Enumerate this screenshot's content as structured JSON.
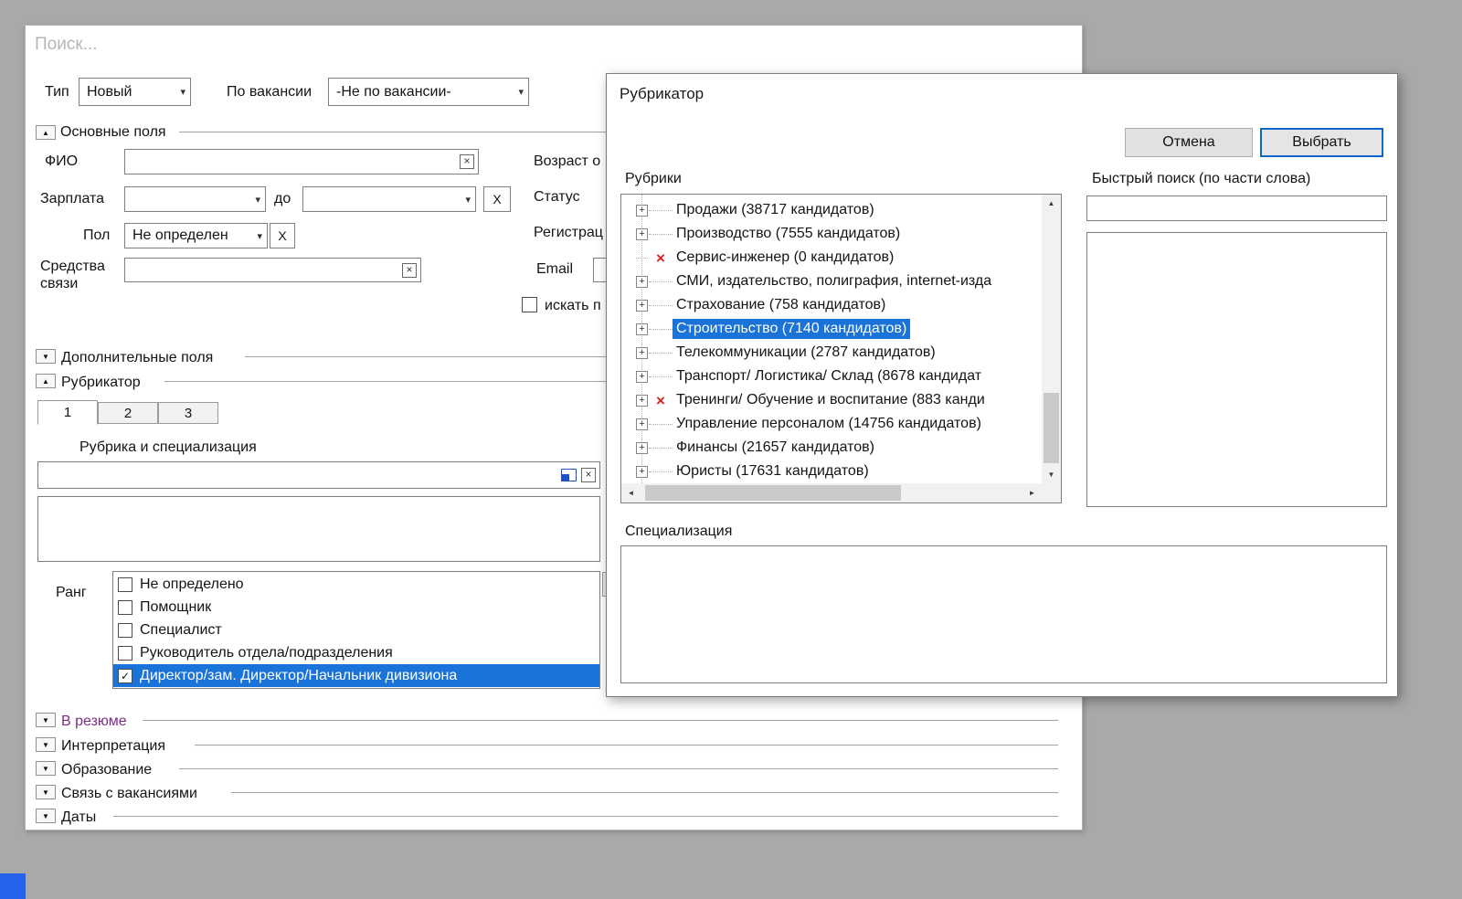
{
  "colors": {
    "selection_blue": "#1a73d9",
    "deleted_red": "#d81e1e",
    "default_button_border": "#0b68c9",
    "resume_purple": "#7d2c84",
    "background_gray": "#a9a9a9",
    "start_chip_blue": "#2563eb"
  },
  "icons": {
    "collapse_up": "▲",
    "collapse_down": "▼",
    "combo_chevron": "▾",
    "clear_x": "×",
    "deleted_x": "×",
    "expand_plus": "+",
    "check": "✓",
    "scroll_up": "▲",
    "scroll_down": "▼",
    "scroll_left": "◄",
    "scroll_right": "►"
  },
  "search_window": {
    "title": "Поиск...",
    "toolbar": {
      "type_label": "Тип",
      "type_value": "Новый",
      "by_vacancy_label": "По вакансии",
      "by_vacancy_value": "-Не по вакансии-"
    },
    "main_fields": {
      "section_label": "Основные поля",
      "fio_label": "ФИО",
      "salary_label": "Зарплата",
      "salary_to_label": "до",
      "salary_clear_label": "X",
      "gender_label": "Пол",
      "gender_value": "Не определен",
      "gender_clear_label": "X",
      "contacts_label_line1": "Средства",
      "contacts_label_line2": "связи",
      "age_label": "Возраст о",
      "status_label": "Статус",
      "registration_label": "Регистрац",
      "email_label": "Email",
      "search_by_checkbox_label": "искать п"
    },
    "additional_fields_label": "Дополнительные поля",
    "rubricator_section": {
      "section_label": "Рубрикатор",
      "tabs": [
        "1",
        "2",
        "3"
      ],
      "active_tab": "1",
      "rubric_label": "Рубрика и специализация",
      "rank_label": "Ранг",
      "rank_options": [
        {
          "label": "Не определено",
          "checked": false,
          "selected": false
        },
        {
          "label": "Помощник",
          "checked": false,
          "selected": false
        },
        {
          "label": "Специалист",
          "checked": false,
          "selected": false
        },
        {
          "label": "Руководитель отдела/подразделения",
          "checked": false,
          "selected": false
        },
        {
          "label": "Директор/зам. Директор/Начальник дивизиона",
          "checked": true,
          "selected": true
        }
      ]
    },
    "collapsed_sections": [
      {
        "label": "В резюме",
        "accent": "purple"
      },
      {
        "label": "Интерпретация",
        "accent": "none"
      },
      {
        "label": "Образование",
        "accent": "none"
      },
      {
        "label": "Связь с вакансиями",
        "accent": "none"
      },
      {
        "label": "Даты",
        "accent": "none"
      }
    ]
  },
  "rubricator_dialog": {
    "title": "Рубрикатор",
    "cancel_button": "Отмена",
    "select_button": "Выбрать",
    "rubrics_label": "Рубрики",
    "quick_search_label": "Быстрый поиск (по части слова)",
    "quick_search_value": "",
    "specialization_label": "Специализация",
    "tree_items": [
      {
        "label": "Продажи  (38717 кандидатов)",
        "expandable": true,
        "deleted": false,
        "selected": false
      },
      {
        "label": "Производство (7555 кандидатов)",
        "expandable": true,
        "deleted": false,
        "selected": false
      },
      {
        "label": "Сервис-инженер (0 кандидатов)",
        "expandable": false,
        "deleted": true,
        "selected": false
      },
      {
        "label": "СМИ, издательство, полиграфия, internet-изда",
        "expandable": true,
        "deleted": false,
        "selected": false
      },
      {
        "label": "Страхование (758 кандидатов)",
        "expandable": true,
        "deleted": false,
        "selected": false
      },
      {
        "label": "Строительство (7140 кандидатов)",
        "expandable": true,
        "deleted": false,
        "selected": true
      },
      {
        "label": "Телекоммуникации  (2787 кандидатов)",
        "expandable": true,
        "deleted": false,
        "selected": false
      },
      {
        "label": "Транспорт/ Логистика/ Склад (8678 кандидат",
        "expandable": true,
        "deleted": false,
        "selected": false
      },
      {
        "label": "Тренинги/ Обучение и воспитание (883 канди",
        "expandable": true,
        "deleted": true,
        "selected": false
      },
      {
        "label": "Управление персоналом  (14756 кандидатов)",
        "expandable": true,
        "deleted": false,
        "selected": false
      },
      {
        "label": "Финансы (21657 кандидатов)",
        "expandable": true,
        "deleted": false,
        "selected": false
      },
      {
        "label": "Юристы (17631 кандидатов)",
        "expandable": true,
        "deleted": false,
        "selected": false
      }
    ]
  }
}
